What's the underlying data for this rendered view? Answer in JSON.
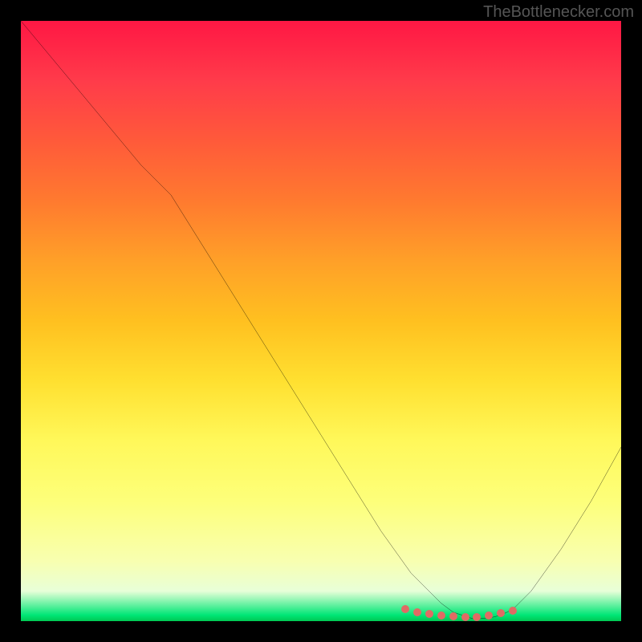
{
  "watermark": "TheBottlenecker.com",
  "chart_data": {
    "type": "line",
    "title": "",
    "xlabel": "",
    "ylabel": "",
    "xlim": [
      0,
      100
    ],
    "ylim": [
      0,
      100
    ],
    "x": [
      0,
      5,
      10,
      15,
      20,
      25,
      30,
      35,
      40,
      45,
      50,
      55,
      60,
      65,
      70,
      72,
      75,
      78,
      80,
      82,
      85,
      90,
      95,
      100
    ],
    "y": [
      100,
      94,
      88,
      82,
      76,
      71,
      63,
      55,
      47,
      39,
      31,
      23,
      15,
      8,
      3,
      1.5,
      0.5,
      0.5,
      1,
      2,
      5,
      12,
      20,
      29
    ],
    "markers": {
      "x": [
        64,
        66,
        68,
        70,
        72,
        74,
        76,
        78,
        80,
        82
      ],
      "y": [
        2.0,
        1.5,
        1.2,
        1.0,
        0.8,
        0.7,
        0.7,
        1.0,
        1.4,
        1.8
      ],
      "color": "#e06b64"
    },
    "background": "heat-gradient"
  }
}
